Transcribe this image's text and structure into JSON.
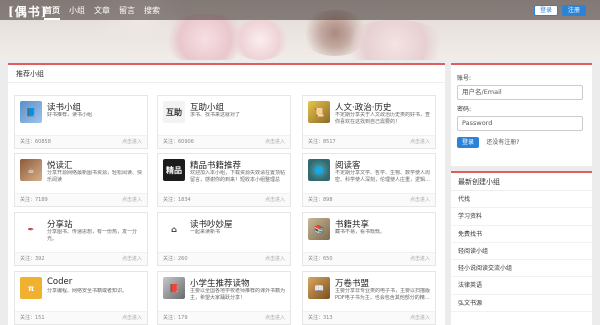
{
  "header": {
    "logo": "偶书",
    "nav": [
      "首页",
      "小组",
      "文章",
      "留言",
      "搜索"
    ],
    "login_label": "登录",
    "register_label": "注册"
  },
  "main": {
    "title": "推荐小组",
    "groups": [
      {
        "name": "读书小组",
        "desc": "好书推荐，读书小组",
        "followers": "关注：60858",
        "enter": "点击进入",
        "icon": "book-icon"
      },
      {
        "name": "互助小组",
        "desc": "求书、找书来这就对了",
        "followers": "关注：60906",
        "enter": "点击进入",
        "icon": "mutual-help-icon"
      },
      {
        "name": "人文·政治·历史",
        "desc": "不定期分享关于人文政治历史类的好书，查你喜欢在这找到自己需要的！",
        "followers": "关注：8517",
        "enter": "点击进入",
        "icon": "history-icon"
      },
      {
        "name": "悦读汇",
        "desc": "分享开源网络最新图书资源，轻松阅读、快乐阅读",
        "followers": "关注：7189",
        "enter": "点击进入",
        "icon": "reading-icon"
      },
      {
        "name": "精品书籍推荐",
        "desc": "欢迎加入本小组，下载资源失效请在置顶帖留言，感谢你的到来！短收本小组整理总结…",
        "followers": "关注：1834",
        "enter": "点击进入",
        "icon": "quality-books-icon"
      },
      {
        "name": "阅读客",
        "desc": "不定期分享文学、哲学、生物、数学使人周密、科学使人深刻，伦理使人庄重，逻辑…",
        "followers": "关注：898",
        "enter": "点击进入",
        "icon": "globe-icon"
      },
      {
        "name": "分享站",
        "desc": "分享图书、传递思想，有一份热，发一分光。",
        "followers": "关注：392",
        "enter": "点击进入",
        "icon": "share-icon"
      },
      {
        "name": "读书吵妙屋",
        "desc": "一起来读新书",
        "followers": "关注：260",
        "enter": "点击进入",
        "icon": "house-icon"
      },
      {
        "name": "书籍共享",
        "desc": "藏书不易，看书慨慨。",
        "followers": "关注：650",
        "enter": "点击进入",
        "icon": "shared-books-icon"
      },
      {
        "name": "Coder",
        "desc": "分享编程、网络安全书籍或者知识。",
        "followers": "关注：151",
        "enter": "点击进入",
        "icon": "coder-icon"
      },
      {
        "name": "小学生推荐读物",
        "desc": "主要以全国各地学校老师推荐的课外书籍为主，希望大家踊跃分享！",
        "followers": "关注：179",
        "enter": "点击进入",
        "icon": "kids-reading-icon"
      },
      {
        "name": "万卷书盟",
        "desc": "主要分享非专业类的电子书，主要以扫描版PDF电子书为主，也会包含其他部分的精…",
        "followers": "关注：313",
        "enter": "点击进入",
        "icon": "library-icon"
      }
    ]
  },
  "login": {
    "account_label": "账号:",
    "account_placeholder": "用户名/Email",
    "password_label": "密码:",
    "password_placeholder": "Password",
    "login_button": "登录",
    "register_prompt": "还没有注册?"
  },
  "new_groups": {
    "title": "最新创建小组",
    "items": [
      "代找",
      "学习资料",
      "免费找书",
      "轻阅读小组",
      "轻小说阅读交流小组",
      "法律英语",
      "弘文书源"
    ]
  }
}
